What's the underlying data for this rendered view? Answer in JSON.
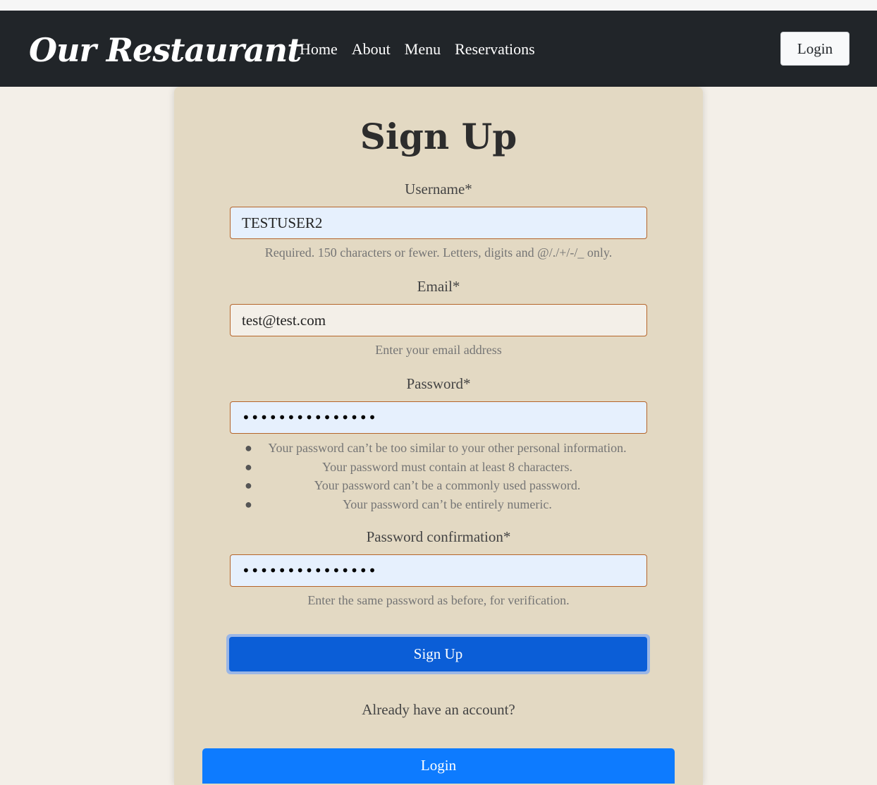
{
  "nav": {
    "brand": "Our Restaurant",
    "links": [
      "Home",
      "About",
      "Menu",
      "Reservations"
    ],
    "login_label": "Login"
  },
  "form": {
    "title": "Sign Up",
    "username": {
      "label": "Username*",
      "value": "TESTUSER2",
      "help": "Required. 150 characters or fewer. Letters, digits and @/./+/-/_ only."
    },
    "email": {
      "label": "Email*",
      "value": "test@test.com",
      "help": "Enter your email address"
    },
    "password": {
      "label": "Password*",
      "value": "•••••••••••••••",
      "rules": [
        "Your password can’t be too similar to your other personal information.",
        "Your password must contain at least 8 characters.",
        "Your password can’t be a commonly used password.",
        "Your password can’t be entirely numeric."
      ]
    },
    "password_confirmation": {
      "label": "Password confirmation*",
      "value": "•••••••••••••••",
      "help": "Enter the same password as before, for verification."
    },
    "submit_label": "Sign Up",
    "already_text": "Already have an account?",
    "login_label": "Login"
  },
  "colors": {
    "navbar": "#212529",
    "card": "#e3d9c3",
    "page": "#f3efe8",
    "primary": "#0b5ed7",
    "login_button": "#0d7bff"
  }
}
